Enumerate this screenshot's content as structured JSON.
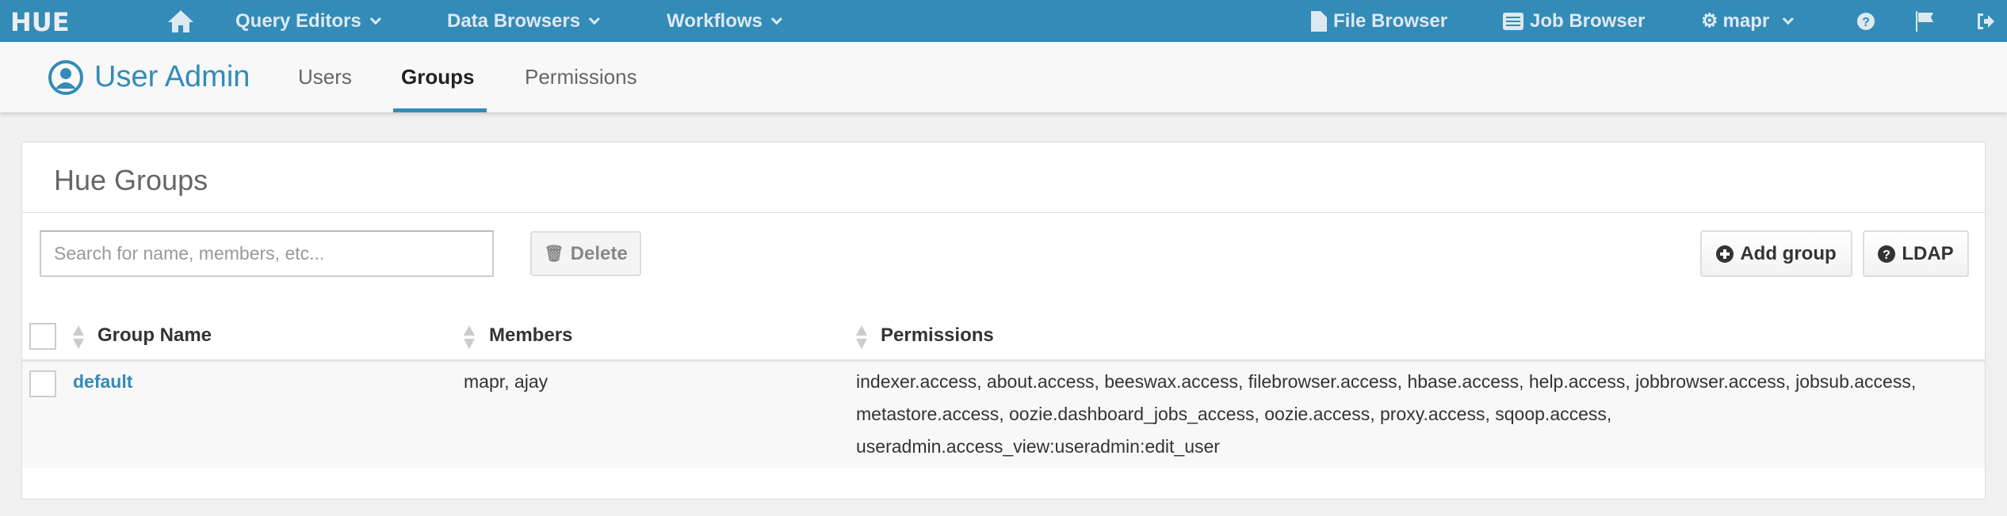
{
  "topnav": {
    "logo": "HUE",
    "home": "home-icon",
    "query_editors": "Query Editors",
    "data_browsers": "Data Browsers",
    "workflows": "Workflows",
    "file_browser": "File Browser",
    "job_browser": "Job Browser",
    "user": "mapr"
  },
  "subnav": {
    "app_title": "User Admin",
    "tabs": [
      "Users",
      "Groups",
      "Permissions"
    ],
    "active": "Groups"
  },
  "panel": {
    "title": "Hue Groups",
    "search_placeholder": "Search for name, members, etc...",
    "delete_label": "Delete",
    "add_group_label": "Add group",
    "ldap_label": "LDAP"
  },
  "table": {
    "headers": [
      "Group Name",
      "Members",
      "Permissions"
    ],
    "rows": [
      {
        "name": "default",
        "members": "mapr, ajay",
        "permissions": "indexer.access, about.access, beeswax.access, filebrowser.access, hbase.access, help.access, jobbrowser.access, jobsub.access, metastore.access, oozie.dashboard_jobs_access, oozie.access, proxy.access, sqoop.access, useradmin.access_view:useradmin:edit_user"
      }
    ]
  },
  "colors": {
    "brand": "#338bb8",
    "link": "#338bb8"
  }
}
